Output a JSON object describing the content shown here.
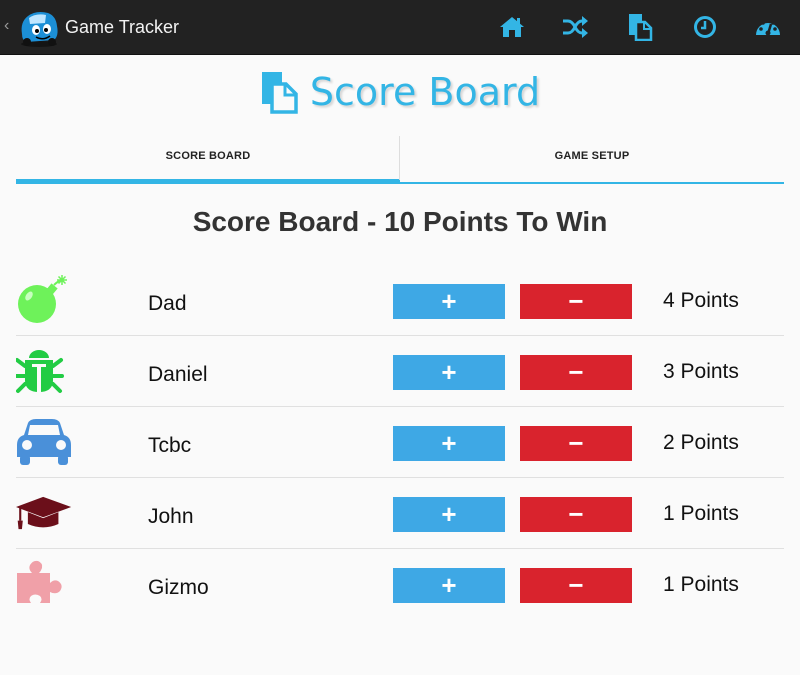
{
  "actionbar": {
    "title": "Game Tracker",
    "back_glyph": "‹",
    "actions": [
      {
        "name": "home-icon",
        "label": "Home"
      },
      {
        "name": "shuffle-icon",
        "label": "Shuffle"
      },
      {
        "name": "scoreboard-icon",
        "label": "Score Board"
      },
      {
        "name": "clock-icon",
        "label": "Timer"
      },
      {
        "name": "gauge-icon",
        "label": "Dashboard"
      }
    ],
    "accent": "#33b5e5"
  },
  "header": {
    "title": "Score Board"
  },
  "tabs": [
    {
      "label": "SCORE BOARD",
      "active": true
    },
    {
      "label": "GAME SETUP",
      "active": false
    }
  ],
  "board": {
    "title": "Score Board - 10 Points To Win",
    "plus_label": "+",
    "minus_label": "−",
    "players": [
      {
        "name": "Dad",
        "icon": "bomb-icon",
        "score": "4 Points",
        "icon_color": "#6ef25a"
      },
      {
        "name": "Daniel",
        "icon": "bug-icon",
        "score": "3 Points",
        "icon_color": "#22cc44"
      },
      {
        "name": "Tcbc",
        "icon": "car-icon",
        "score": "2 Points",
        "icon_color": "#4a90d9"
      },
      {
        "name": "John",
        "icon": "graduation-cap-icon",
        "score": "1 Points",
        "icon_color": "#6b0f1a"
      },
      {
        "name": "Gizmo",
        "icon": "puzzle-piece-icon",
        "score": "1 Points",
        "icon_color": "#f0a0a8"
      }
    ]
  },
  "colors": {
    "plus": "#3ea8e5",
    "minus": "#d9232d"
  }
}
